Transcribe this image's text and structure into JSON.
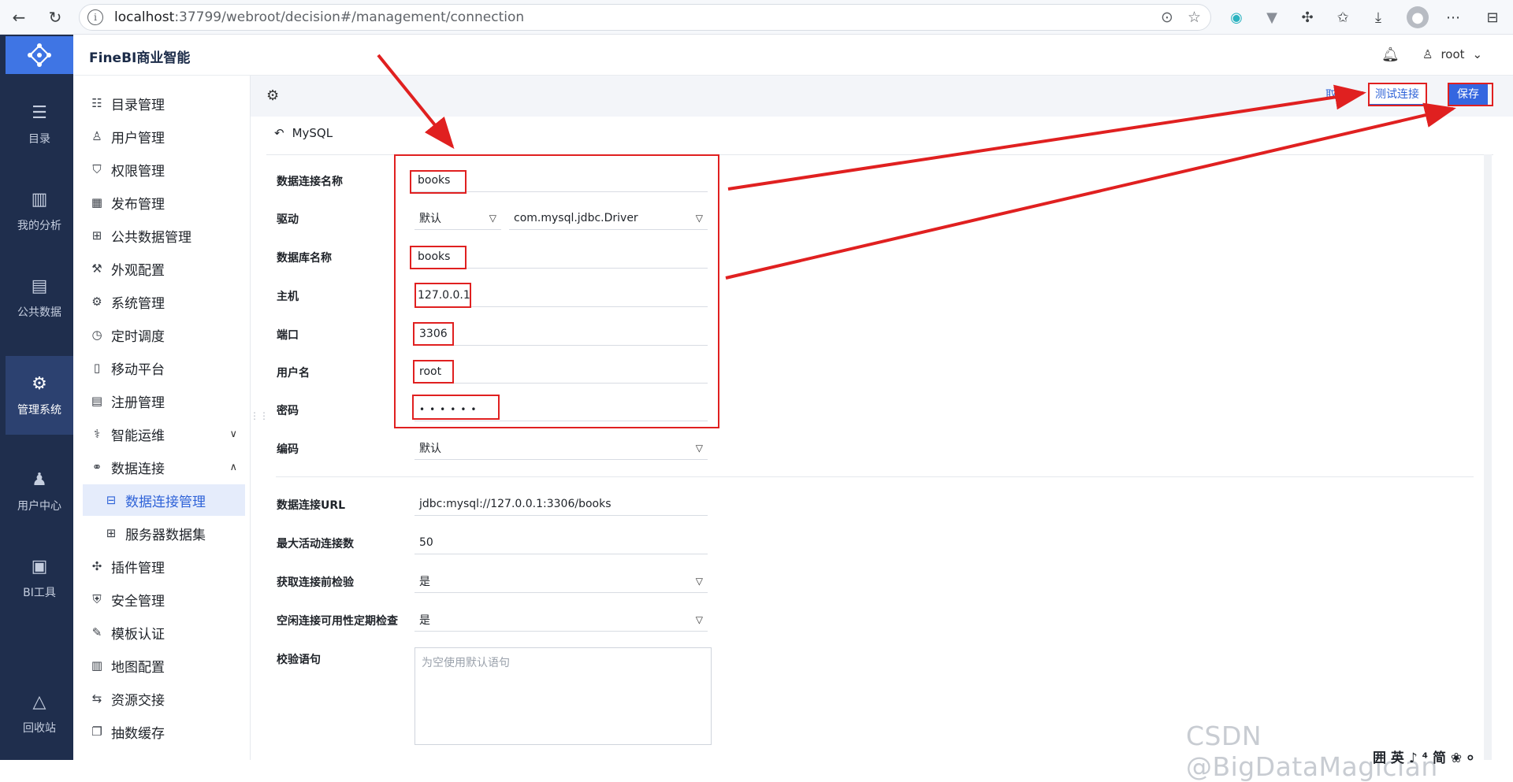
{
  "browser": {
    "url_host": "localhost",
    "url_rest": ":37799/webroot/decision#/management/connection"
  },
  "leftnav": [
    {
      "label": "目录",
      "icon": "catalog-icon"
    },
    {
      "label": "我的分析",
      "icon": "analysis-icon"
    },
    {
      "label": "公共数据",
      "icon": "public-data-icon"
    },
    {
      "label": "管理系统",
      "icon": "management-icon",
      "active": true
    },
    {
      "label": "用户中心",
      "icon": "user-center-icon"
    },
    {
      "label": "BI工具",
      "icon": "bi-tools-icon"
    },
    {
      "label": "回收站",
      "icon": "recycle-icon"
    }
  ],
  "header": {
    "title": "FineBI商业智能",
    "user": "root"
  },
  "sidebar": [
    {
      "label": "目录管理"
    },
    {
      "label": "用户管理"
    },
    {
      "label": "权限管理"
    },
    {
      "label": "发布管理"
    },
    {
      "label": "公共数据管理"
    },
    {
      "label": "外观配置"
    },
    {
      "label": "系统管理"
    },
    {
      "label": "定时调度"
    },
    {
      "label": "移动平台"
    },
    {
      "label": "注册管理"
    },
    {
      "label": "智能运维"
    },
    {
      "label": "数据连接"
    },
    {
      "label": "数据连接管理"
    },
    {
      "label": "服务器数据集"
    },
    {
      "label": "插件管理"
    },
    {
      "label": "安全管理"
    },
    {
      "label": "模板认证"
    },
    {
      "label": "地图配置"
    },
    {
      "label": "资源交接"
    },
    {
      "label": "抽数缓存"
    }
  ],
  "toolbar": {
    "cancel": "取消",
    "test": "测试连接",
    "save": "保存"
  },
  "back_label": "MySQL",
  "form": {
    "conn_name_label": "数据连接名称",
    "conn_name": "books",
    "driver_label": "驱动",
    "driver_mode": "默认",
    "driver_class": "com.mysql.jdbc.Driver",
    "db_name_label": "数据库名称",
    "db_name": "books",
    "host_label": "主机",
    "host": "127.0.0.1",
    "port_label": "端口",
    "port": "3306",
    "username_label": "用户名",
    "username": "root",
    "password_label": "密码",
    "password": "••••••",
    "encoding_label": "编码",
    "encoding": "默认",
    "url_label": "数据连接URL",
    "url": "jdbc:mysql://127.0.0.1:3306/books",
    "max_active_label": "最大活动连接数",
    "max_active": "50",
    "validate_label": "获取连接前检验",
    "validate": "是",
    "idle_check_label": "空闲连接可用性定期检查",
    "idle_check": "是",
    "query_label": "校验语句",
    "query_placeholder": "为空使用默认语句"
  },
  "watermark": "CSDN @BigDataMagician",
  "ime": "囲 英 ♪ ⁴ 简 ❀ ⸰",
  "annotation_color": "#e02020"
}
